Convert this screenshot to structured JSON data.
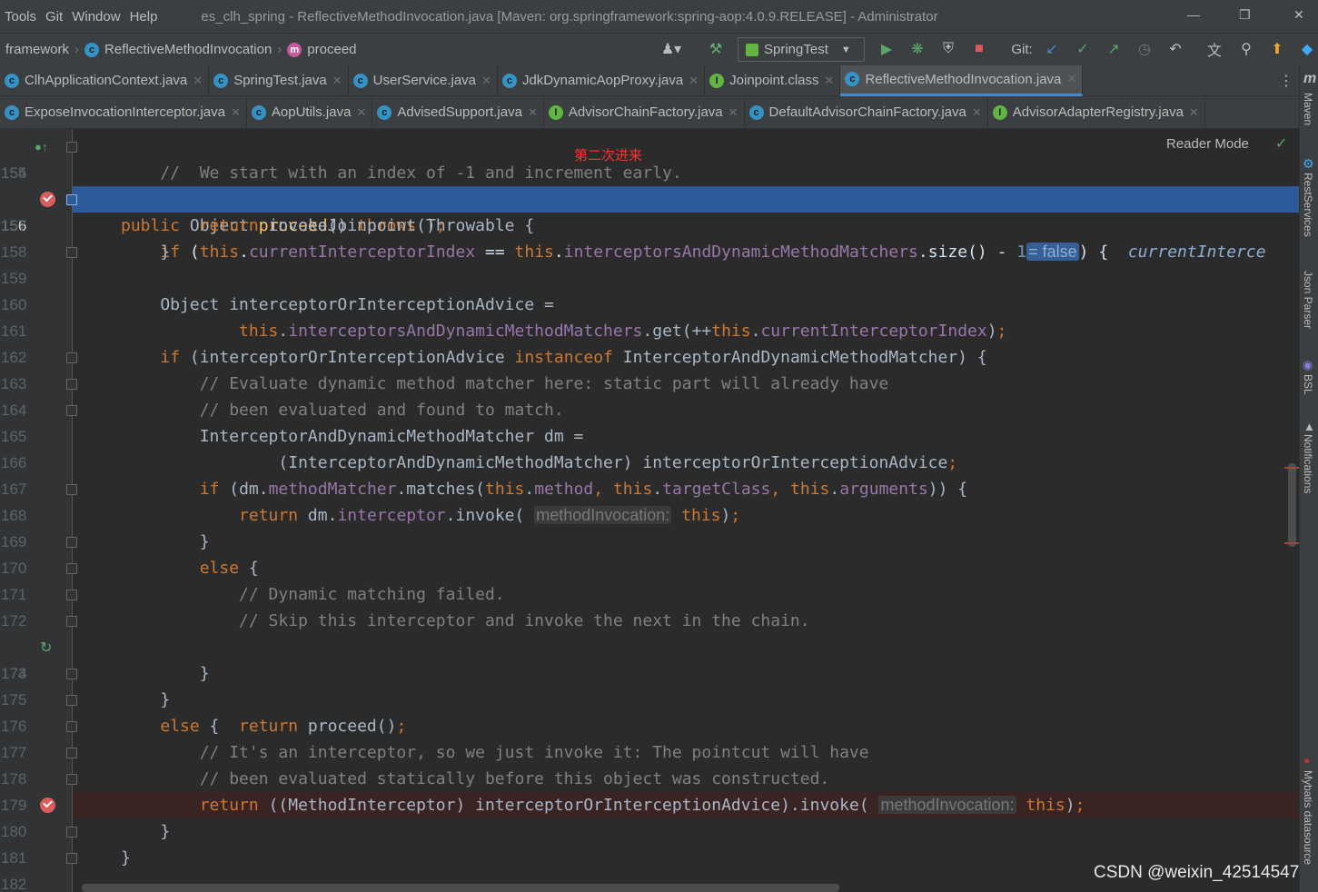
{
  "menu": [
    "Tools",
    "Git",
    "Window",
    "Help"
  ],
  "window_title": "es_clh_spring - ReflectiveMethodInvocation.java [Maven: org.springframework:spring-aop:4.0.9.RELEASE] - Administrator",
  "breadcrumb": {
    "project": "framework",
    "class": "ReflectiveMethodInvocation",
    "method": "proceed"
  },
  "run_config": "SpringTest",
  "git_label": "Git:",
  "tabs_row1": [
    {
      "label": "ClhApplicationContext.java",
      "icon": "class-icon"
    },
    {
      "label": "SpringTest.java",
      "icon": "class-icon"
    },
    {
      "label": "UserService.java",
      "icon": "class-icon"
    },
    {
      "label": "JdkDynamicAopProxy.java",
      "icon": "class-icon"
    },
    {
      "label": "Joinpoint.class",
      "icon": "interface-icon"
    },
    {
      "label": "ReflectiveMethodInvocation.java",
      "icon": "class-icon",
      "active": true
    }
  ],
  "tabs_row2": [
    {
      "label": "ExposeInvocationInterceptor.java",
      "icon": "class-icon"
    },
    {
      "label": "AopUtils.java",
      "icon": "class-icon"
    },
    {
      "label": "AdvisedSupport.java",
      "icon": "class-icon"
    },
    {
      "label": "AdvisorChainFactory.java",
      "icon": "interface-icon"
    },
    {
      "label": "DefaultAdvisorChainFactory.java",
      "icon": "class-icon"
    },
    {
      "label": "AdvisorAdapterRegistry.java",
      "icon": "interface-icon"
    }
  ],
  "reader_mode": "Reader Mode",
  "annotation": "第二次进来",
  "line_numbers": [
    "154",
    "155",
    "156",
    "157",
    "158",
    "159",
    "160",
    "161",
    "162",
    "163",
    "164",
    "165",
    "166",
    "167",
    "168",
    "169",
    "170",
    "171",
    "172",
    "173",
    "174",
    "175",
    "176",
    "177",
    "178",
    "179",
    "180",
    "181",
    "182"
  ],
  "inline_hints": {
    "cond_value": "= false",
    "param_name": "methodInvocation:",
    "inline_var": "currentInterce"
  },
  "side_panels": [
    "Maven",
    "RestServices",
    "Json Parser",
    "BSL",
    "Notifications",
    "Mybatis datasource"
  ],
  "watermark": "CSDN @weixin_42514547"
}
